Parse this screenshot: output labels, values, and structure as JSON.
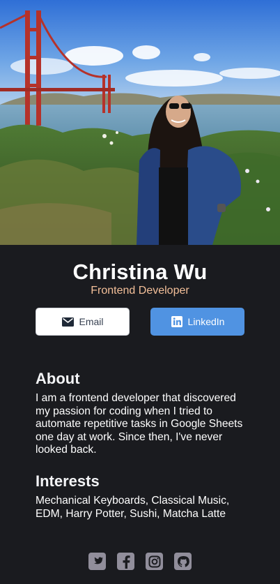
{
  "profile": {
    "name": "Christina Wu",
    "role": "Frontend Developer",
    "photo_icon": "profile-photo"
  },
  "buttons": {
    "email": {
      "label": "Email",
      "icon": "mail-icon"
    },
    "linkedin": {
      "label": "LinkedIn",
      "icon": "linkedin-icon"
    }
  },
  "about": {
    "title": "About",
    "text": "I am a frontend developer that discovered my passion for coding when I tried to automate repetitive tasks in Google Sheets one day at work. Since then, I've never looked back."
  },
  "interests": {
    "title": "Interests",
    "text": "Mechanical Keyboards, Classical Music, EDM, Harry Potter, Sushi, Matcha Latte"
  },
  "footer": {
    "icons": [
      "twitter-icon",
      "facebook-icon",
      "instagram-icon",
      "github-icon"
    ]
  },
  "colors": {
    "background": "#1a1b1f",
    "accent": "#f3bf99",
    "linkedin": "#5093e2",
    "footer_icon": "#918e9b"
  }
}
